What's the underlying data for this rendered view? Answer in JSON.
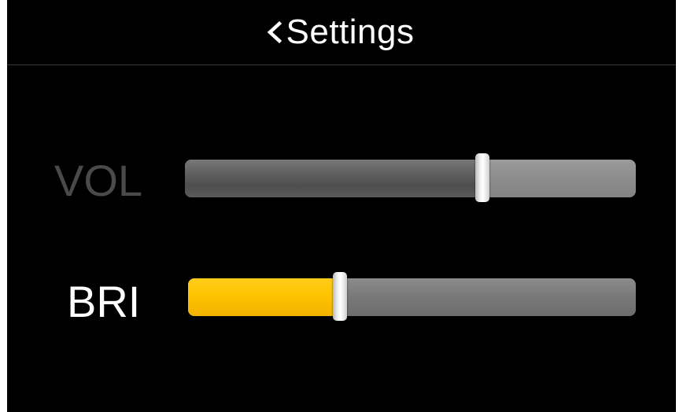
{
  "header": {
    "title": "Settings",
    "back_icon": "chevron-left-icon"
  },
  "sliders": [
    {
      "id": "vol",
      "label": "VOL",
      "value_fraction": 0.66,
      "enabled": false,
      "fill_color": "#5a5a5a",
      "track_color": "#8d8d8d"
    },
    {
      "id": "bri",
      "label": "BRI",
      "value_fraction": 0.34,
      "enabled": true,
      "fill_color": "#ffc400",
      "track_color": "#7a7a7a"
    }
  ],
  "colors": {
    "background": "#000000",
    "text_active": "#ffffff",
    "text_disabled": "#4a4a4a",
    "accent": "#ffc400"
  }
}
